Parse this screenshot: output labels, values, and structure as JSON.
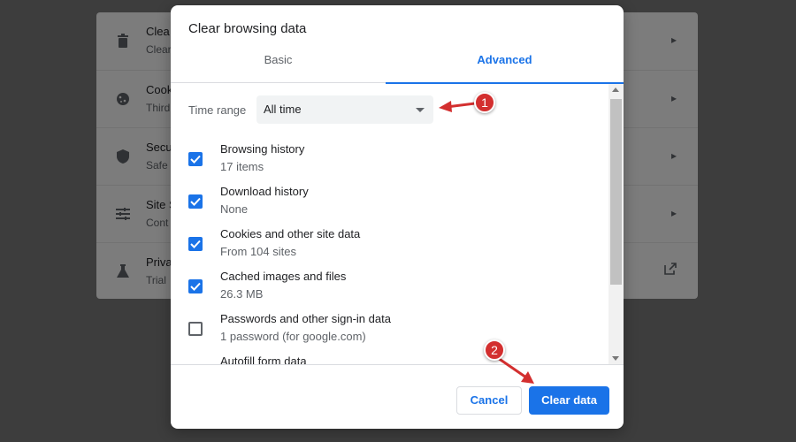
{
  "background": {
    "rows": [
      {
        "icon": "trash-icon",
        "title": "Clea",
        "subtitle": "Clear",
        "action": "chevron"
      },
      {
        "icon": "cookie-icon",
        "title": "Cook",
        "subtitle": "Third",
        "action": "chevron"
      },
      {
        "icon": "shield-icon",
        "title": "Secu",
        "subtitle": "Safe",
        "action": "chevron"
      },
      {
        "icon": "sliders-icon",
        "title": "Site S",
        "subtitle": "Cont",
        "action": "chevron"
      },
      {
        "icon": "flask-icon",
        "title": "Priva",
        "subtitle": "Trial",
        "action": "external-link"
      }
    ]
  },
  "dialog": {
    "title": "Clear browsing data",
    "tabs": [
      {
        "label": "Basic",
        "active": false
      },
      {
        "label": "Advanced",
        "active": true
      }
    ],
    "time_range": {
      "label": "Time range",
      "value": "All time"
    },
    "items": [
      {
        "label": "Browsing history",
        "detail": "17 items",
        "checked": true
      },
      {
        "label": "Download history",
        "detail": "None",
        "checked": true
      },
      {
        "label": "Cookies and other site data",
        "detail": "From 104 sites",
        "checked": true
      },
      {
        "label": "Cached images and files",
        "detail": "26.3 MB",
        "checked": true
      },
      {
        "label": "Passwords and other sign-in data",
        "detail": "1 password (for google.com)",
        "checked": false
      },
      {
        "label": "Autofill form data",
        "detail": "",
        "checked": false
      }
    ],
    "buttons": {
      "cancel": "Cancel",
      "clear": "Clear data"
    }
  },
  "annotations": [
    {
      "number": "1"
    },
    {
      "number": "2"
    }
  ],
  "colors": {
    "accent": "#1a73e8",
    "annotation": "#d32f2f"
  }
}
